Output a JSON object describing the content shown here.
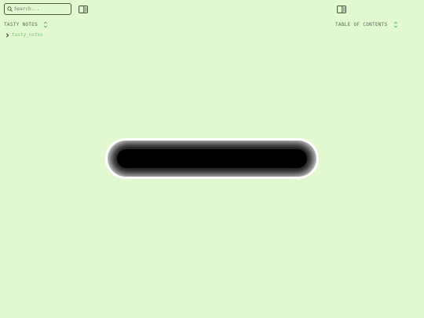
{
  "search": {
    "placeholder": "Search..."
  },
  "left_panel": {
    "header": "TASTY NOTES",
    "tree": [
      {
        "name": "tasty_notes",
        "expanded": false
      }
    ]
  },
  "right_panel": {
    "header": "TABLE OF CONTENTS"
  },
  "loading": {
    "state": "loading"
  },
  "colors": {
    "background": "#e2f8d1",
    "accent": "#7fc67a",
    "muted_text": "#5a6a56"
  },
  "icons": {
    "search": "search-icon",
    "panel_toggle": "panel-toggle-icon",
    "sort": "sort-updown-icon",
    "chevron": "chevron-right-icon"
  }
}
